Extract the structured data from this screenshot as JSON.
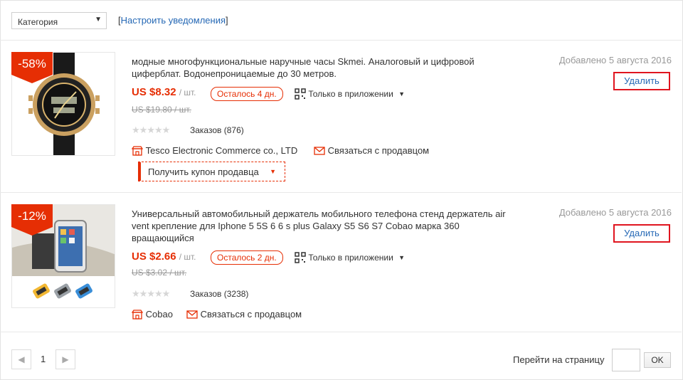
{
  "toolbar": {
    "category_select": "Категория",
    "notify_open": "[",
    "notify_link": "Настроить уведомления",
    "notify_close": "]"
  },
  "items": [
    {
      "discount": "-58%",
      "title": "модные многофункциональные наручные часы Skmei. Аналоговый и цифровой циферблат. Водонепроницаемые до 30 метров.",
      "price": "US $8.32",
      "unit": "/ шт.",
      "remaining": "Осталось 4 дн.",
      "app_only": "Только в приложении",
      "old_price": "US $19.80 / шт.",
      "orders": "Заказов (876)",
      "rating": 0,
      "seller": "Tesco Electronic Commerce co., LTD",
      "contact": "Связаться с продавцом",
      "coupon": "Получить купон продавца",
      "date": "Добавлено 5 августа 2016",
      "delete": "Удалить"
    },
    {
      "discount": "-12%",
      "title": "Универсальный автомобильный держатель мобильного телефона стенд держатель air vent крепление для Iphone 5 5S 6 6 s plus Galaxy S5 S6 S7 Cobao марка 360 вращающийся",
      "price": "US $2.66",
      "unit": "/ шт.",
      "remaining": "Осталось 2 дн.",
      "app_only": "Только в приложении",
      "old_price": "US $3.02 / шт.",
      "orders": "Заказов (3238)",
      "rating": 0,
      "seller": "Cobao",
      "contact": "Связаться с продавцом",
      "date": "Добавлено 5 августа 2016",
      "delete": "Удалить"
    }
  ],
  "pagination": {
    "current_page": "1",
    "goto_label": "Перейти на страницу",
    "goto_value": "",
    "ok": "OK"
  },
  "colors": {
    "accent": "#e62e04",
    "link": "#2568b5",
    "highlight_border": "#e0151f"
  }
}
